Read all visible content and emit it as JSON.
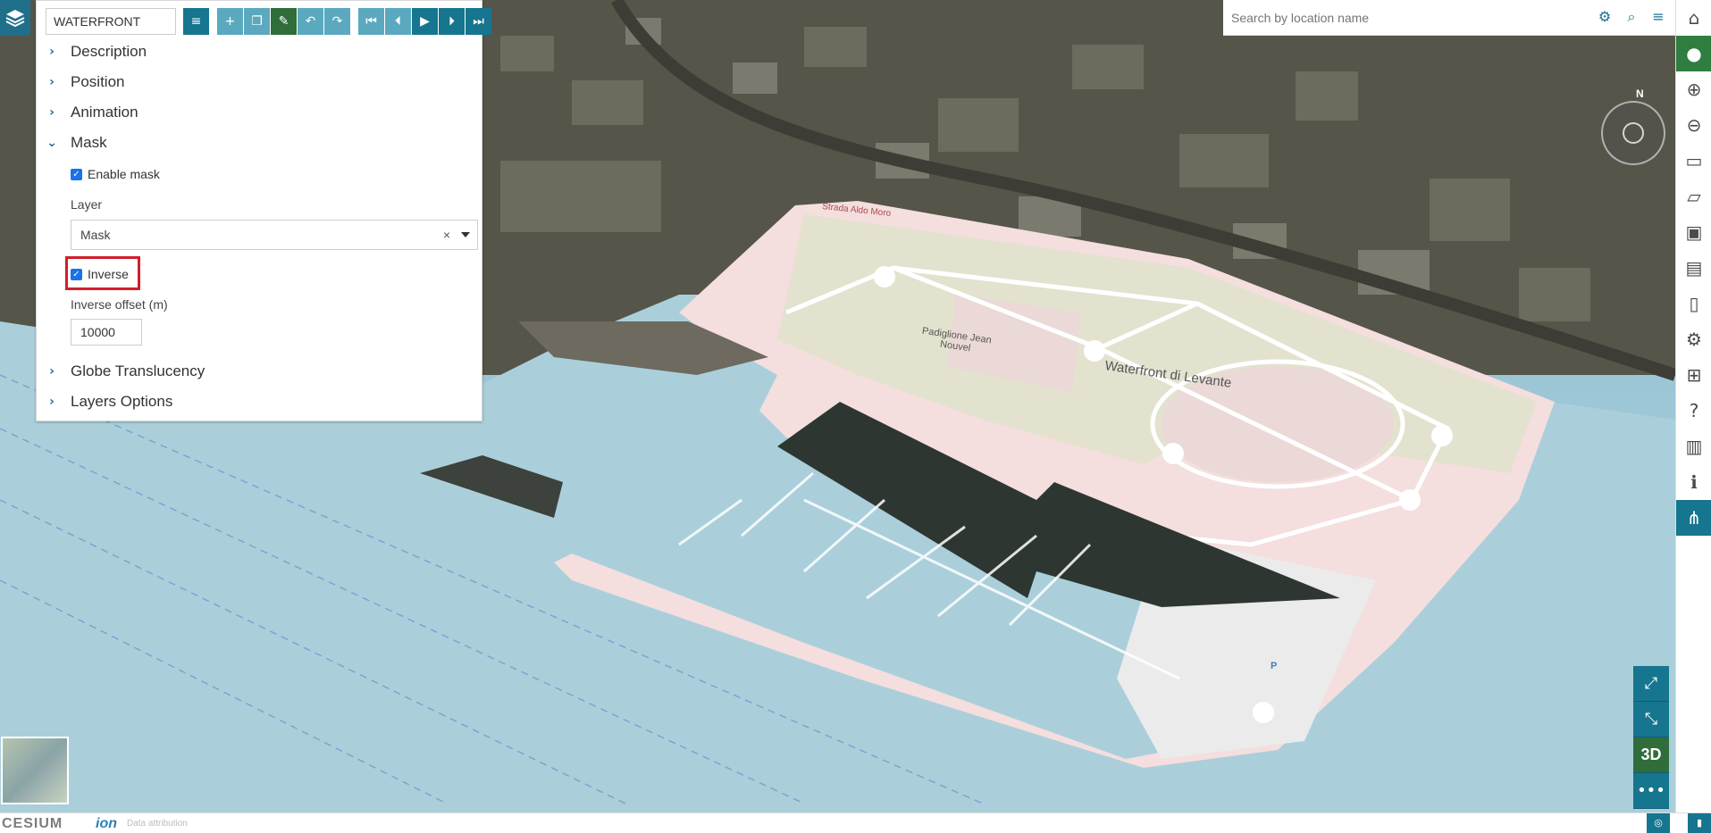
{
  "app": {
    "layers_icon": "layers-icon"
  },
  "panel": {
    "title_value": "WATERFRONT",
    "toolbar_icons": [
      "list-icon",
      "plus-icon",
      "copy-icon",
      "edit-icon",
      "undo-icon",
      "redo-icon",
      "first-icon",
      "prev-icon",
      "play-icon",
      "next-icon",
      "last-icon"
    ],
    "sections": {
      "description": "Description",
      "position": "Position",
      "animation": "Animation",
      "mask": "Mask",
      "globe_translucency": "Globe Translucency",
      "layers_options": "Layers Options"
    },
    "mask": {
      "enable_label": "Enable mask",
      "enable_checked": true,
      "layer_label": "Layer",
      "layer_value": "Mask",
      "inverse_label": "Inverse",
      "inverse_checked": true,
      "offset_label": "Inverse offset (m)",
      "offset_value": "10000"
    }
  },
  "search": {
    "placeholder": "Search by location name"
  },
  "map_labels": {
    "waterfront": "Waterfront di Levante",
    "padiglione": "Padiglione Jean Nouvel",
    "strada": "Strada Aldo Moro",
    "parking": "P"
  },
  "compass": {
    "north": "N"
  },
  "sidebar_icons": [
    "home-icon",
    "user-icon",
    "upload-icon",
    "download-icon",
    "folder-icon",
    "ruler-icon",
    "save-icon",
    "save-as-icon",
    "trash-icon",
    "settings-icon",
    "share-icon",
    "help-icon",
    "book-icon",
    "info-icon",
    "tree-icon"
  ],
  "controls": {
    "mode_3d": "3D",
    "more": "•••"
  },
  "bottombar": {
    "logo": "CESIUM",
    "ion": "ion",
    "attribution": "Data attribution"
  }
}
